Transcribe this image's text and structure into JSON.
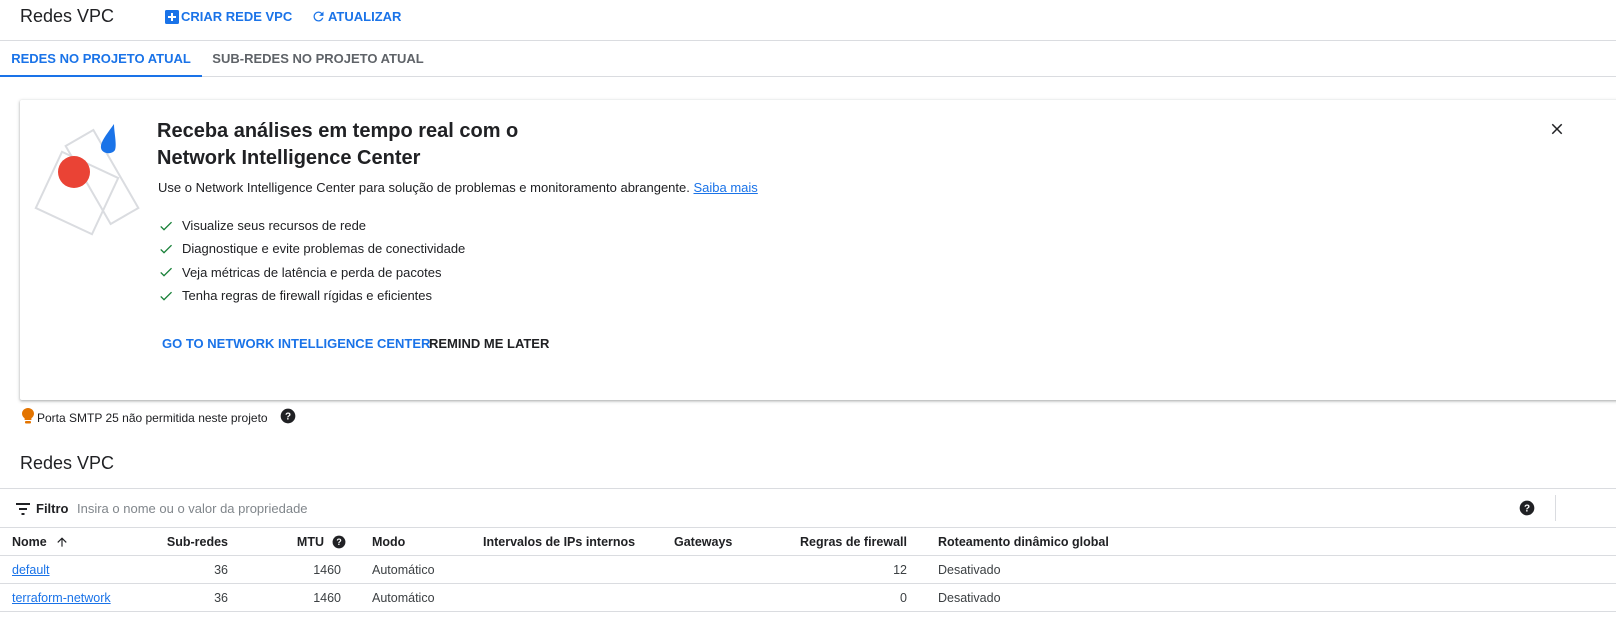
{
  "header": {
    "title": "Redes VPC",
    "create_label": "CRIAR REDE VPC",
    "refresh_label": "ATUALIZAR"
  },
  "tabs": [
    {
      "label": "REDES NO PROJETO ATUAL",
      "active": true
    },
    {
      "label": "SUB-REDES NO PROJETO ATUAL",
      "active": false
    }
  ],
  "banner": {
    "title": "Receba análises em tempo real com o Network Intelligence Center",
    "description": "Use o Network Intelligence Center para solução de problemas e monitoramento abrangente.",
    "learn_more": "Saiba mais",
    "features": [
      "Visualize seus recursos de rede",
      "Diagnostique e evite problemas de conectividade",
      "Veja métricas de latência e perda de pacotes",
      "Tenha regras de firewall rígidas e eficientes"
    ],
    "primary_action": "GO TO NETWORK INTELLIGENCE CENTER",
    "secondary_action": "REMIND ME LATER"
  },
  "notice": {
    "text": "Porta SMTP 25 não permitida neste projeto"
  },
  "section": {
    "title": "Redes VPC"
  },
  "filter": {
    "label": "Filtro",
    "placeholder": "Insira o nome ou o valor da propriedade"
  },
  "table": {
    "columns": [
      "Nome",
      "Sub-redes",
      "MTU",
      "Modo",
      "Intervalos de IPs internos",
      "Gateways",
      "Regras de firewall",
      "Roteamento dinâmico global"
    ],
    "rows": [
      {
        "name": "default",
        "subnets": "36",
        "mtu": "1460",
        "mode": "Automático",
        "internal_ranges": "",
        "gateways": "",
        "firewall_rules": "12",
        "routing": "Desativado"
      },
      {
        "name": "terraform-network",
        "subnets": "36",
        "mtu": "1460",
        "mode": "Automático",
        "internal_ranges": "",
        "gateways": "",
        "firewall_rules": "0",
        "routing": "Desativado"
      }
    ]
  },
  "colors": {
    "accent": "#1a73e8",
    "check": "#188038",
    "warning": "#e37400",
    "border": "#dadce0"
  }
}
